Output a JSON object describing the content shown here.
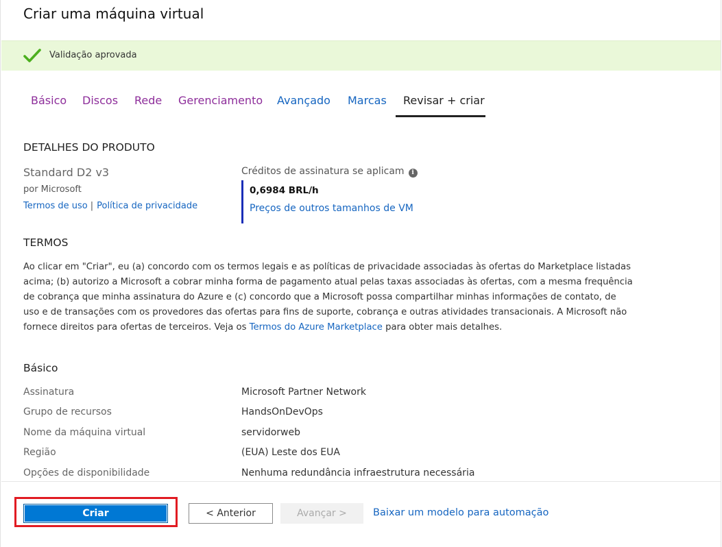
{
  "title": "Criar uma máquina virtual",
  "validation": {
    "text": "Validação aprovada",
    "icon": "check-icon",
    "color": "#4caf1e"
  },
  "tabs": [
    {
      "label": "Básico",
      "state": "visited"
    },
    {
      "label": "Discos",
      "state": "visited"
    },
    {
      "label": "Rede",
      "state": "visited"
    },
    {
      "label": "Gerenciamento",
      "state": "visited"
    },
    {
      "label": "Avançado",
      "state": "link"
    },
    {
      "label": "Marcas",
      "state": "link"
    },
    {
      "label": "Revisar + criar",
      "state": "active"
    }
  ],
  "product": {
    "heading": "DETALHES DO PRODUTO",
    "name": "Standard D2 v3",
    "publisher": "por Microsoft",
    "terms_link": "Termos de uso",
    "separator": "|",
    "privacy_link": "Política de privacidade",
    "pricing_heading": "Créditos de assinatura se aplicam",
    "price": "0,6984 BRL/h",
    "pricing_link": "Preços de outros tamanhos de VM"
  },
  "terms": {
    "heading": "TERMOS",
    "text_before_link": "Ao clicar em \"Criar\", eu (a) concordo com os termos legais e as políticas de privacidade associadas às ofertas do Marketplace listadas acima; (b) autorizo a Microsoft a cobrar minha forma de pagamento atual pelas taxas associadas às ofertas, com a mesma frequência de cobrança que minha assinatura do Azure e (c) concordo que a Microsoft possa compartilhar minhas informações de contato, de uso e de transações com os provedores das ofertas para fins de suporte, cobrança e outras atividades transacionais. A Microsoft não fornece direitos para ofertas de terceiros. Veja os ",
    "link": "Termos do Azure Marketplace",
    "text_after_link": " para obter mais detalhes."
  },
  "basics": {
    "heading": "Básico",
    "rows": [
      {
        "label": "Assinatura",
        "value": "Microsoft Partner Network"
      },
      {
        "label": "Grupo de recursos",
        "value": "HandsOnDevOps"
      },
      {
        "label": "Nome da máquina virtual",
        "value": "servidorweb"
      },
      {
        "label": "Região",
        "value": "(EUA) Leste dos EUA"
      },
      {
        "label": "Opções de disponibilidade",
        "value": "Nenhuma redundância infraestrutura necessária"
      }
    ]
  },
  "footer": {
    "create": "Criar",
    "previous": "< Anterior",
    "next": "Avançar >",
    "template_link": "Baixar um modelo para automação"
  },
  "colors": {
    "primary": "#0078d4",
    "link": "#1565c0",
    "visited": "#8d2d9a",
    "highlight": "#e11b22"
  }
}
